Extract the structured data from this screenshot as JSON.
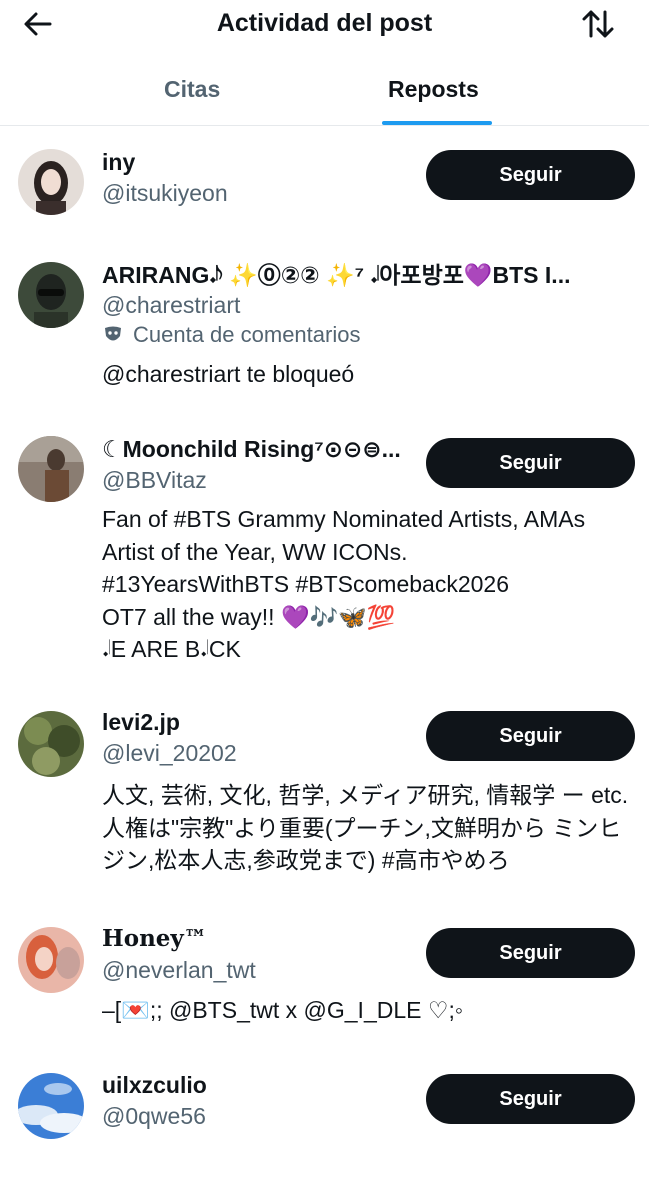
{
  "header": {
    "title": "Actividad del post",
    "back_icon": "arrow-left-icon",
    "sort_icon": "sort-arrows-icon"
  },
  "tabs": [
    {
      "label": "Citas",
      "selected": false
    },
    {
      "label": "Reposts",
      "selected": true
    }
  ],
  "accent_color": "#1d9bf0",
  "follow_label": "Seguir",
  "users": [
    {
      "name": "iny",
      "handle": "@itsukiyeon",
      "bio": "",
      "follow": true
    },
    {
      "name": "ARIRANG𝆺𝅥𝅮 ✨⓪②② ✨⁷ 𝆺𝅥아포방포💜BTS I...",
      "handle": "@charestriart",
      "sub": "Cuenta de comentarios",
      "bio": "@charestriart te bloqueó",
      "follow": false
    },
    {
      "name": "☾Moonchild Rising⁷⊙⊝⊜...",
      "handle": "@BBVitaz",
      "bio": "Fan of #BTS Grammy Nominated Artists, AMAs Artist of the Year, WW ICONs.\n#13YearsWithBTS #BTScomeback2026\nOT7 all the way!! 💜🎶🦋💯\n𝆺𝅥E ARE B𝆺𝅥CK",
      "follow": true
    },
    {
      "name": "levi2.jp",
      "handle": "@levi_20202",
      "bio": "人文, 芸術, 文化, 哲学, メディア研究, 情報学 ー etc. 人権は\"宗教\"より重要(プーチン,文鮮明から ミンヒジン,松本人志,参政党まで) #高市やめろ",
      "follow": true
    },
    {
      "name": "Honey™",
      "handle": "@neverlan_twt",
      "bio": "–[💌;; @BTS_twt x @G_I_DLE ♡;◦",
      "follow": true
    },
    {
      "name": "uilxzculio",
      "handle": "@0qwe56",
      "bio": "",
      "follow": true
    }
  ]
}
